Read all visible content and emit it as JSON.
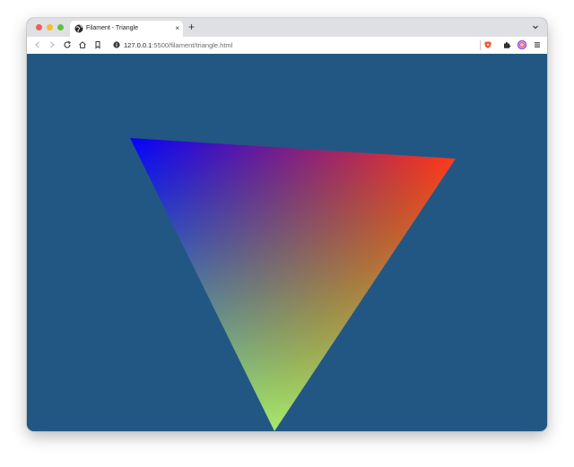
{
  "tab": {
    "title": "Filament - Triangle",
    "close_glyph": "×",
    "new_tab_glyph": "+"
  },
  "address_bar": {
    "host": "127.0.0.1",
    "path": ":5500/filament/triangle.html"
  },
  "icons": {
    "tab_favicon": "globe-icon",
    "back": "back-arrow-icon",
    "forward": "forward-arrow-icon",
    "reload": "reload-icon",
    "home": "home-icon",
    "bookmark": "bookmark-icon",
    "site_info": "info-icon",
    "brave_shields": "brave-lion-icon",
    "extensions": "puzzle-icon",
    "wallet": "wallet-icon",
    "menu": "hamburger-menu-icon",
    "tab_list": "chevron-down-icon"
  },
  "colors": {
    "canvas_background": "#225784",
    "vertex_top_left": "#0000ff",
    "vertex_top_right": "#ff3b1f",
    "vertex_bottom": "#a6e86f"
  }
}
